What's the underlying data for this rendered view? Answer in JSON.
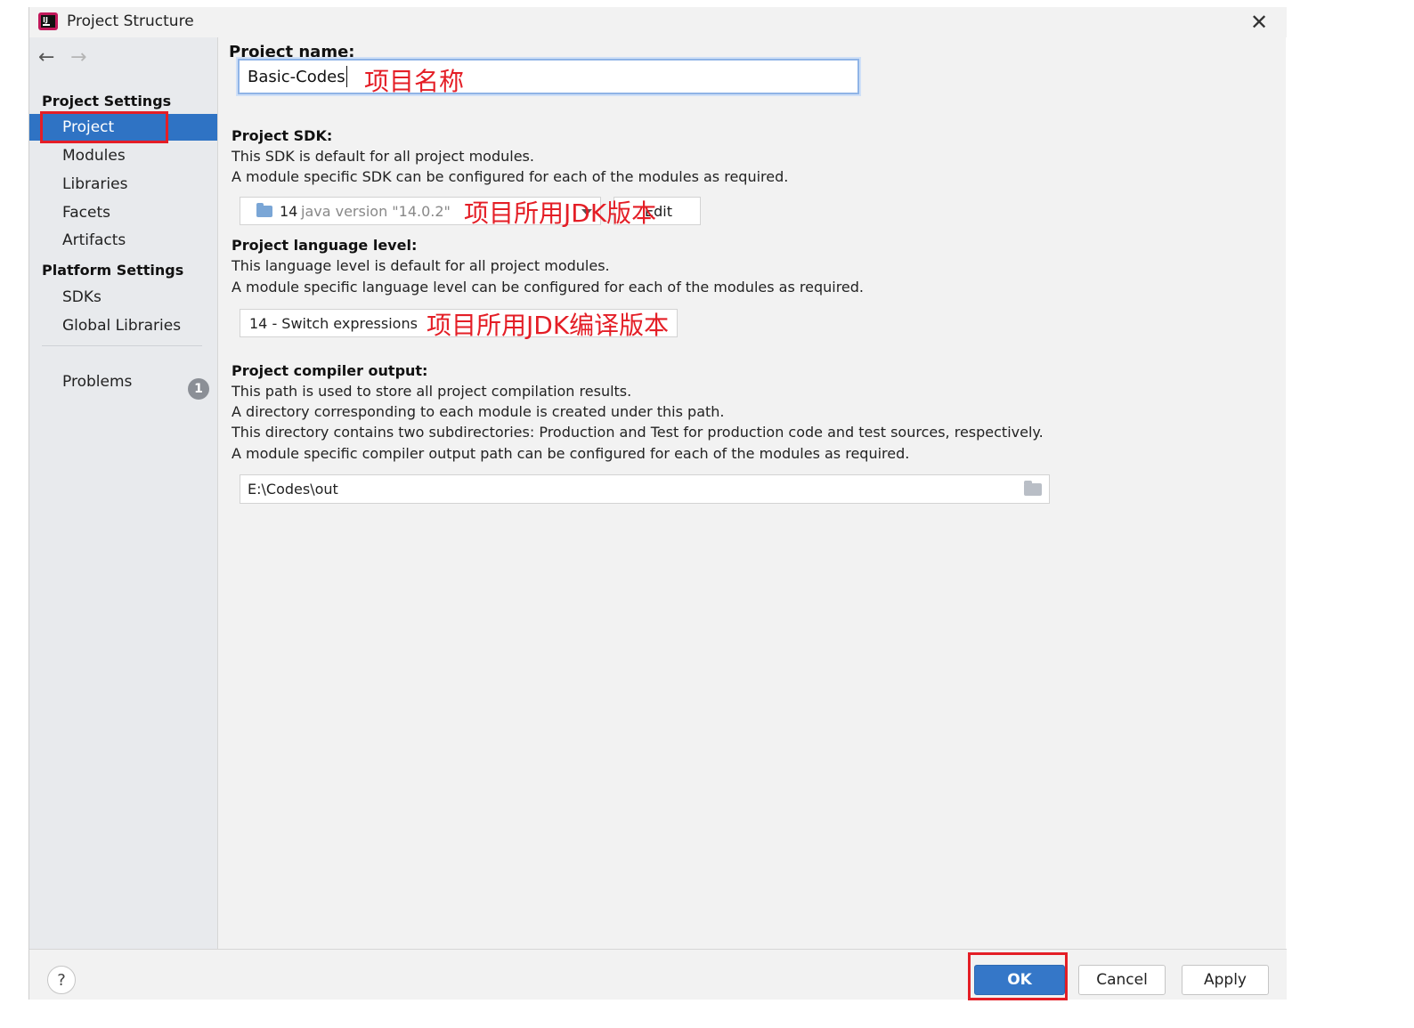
{
  "window": {
    "title": "Project Structure"
  },
  "sidebar": {
    "project_settings_header": "Project Settings",
    "project_items": [
      {
        "label": "Project",
        "selected": true
      },
      {
        "label": "Modules"
      },
      {
        "label": "Libraries"
      },
      {
        "label": "Facets"
      },
      {
        "label": "Artifacts"
      }
    ],
    "platform_settings_header": "Platform Settings",
    "platform_items": [
      {
        "label": "SDKs"
      },
      {
        "label": "Global Libraries"
      }
    ],
    "problems": {
      "label": "Problems",
      "count": "1"
    }
  },
  "project_name": {
    "label": "Project name:",
    "value": "Basic-Codes",
    "annotation": "项目名称"
  },
  "sdk": {
    "label": "Project SDK:",
    "desc1": "This SDK is default for all project modules.",
    "desc2": "A module specific SDK can be configured for each of the modules as required.",
    "version": "14",
    "version_detail": "java version \"14.0.2\"",
    "edit_label": "Edit",
    "annotation": "项目所用JDK版本"
  },
  "language_level": {
    "label": "Project language level:",
    "desc1": "This language level is default for all project modules.",
    "desc2": "A module specific language level can be configured for each of the modules as required.",
    "value": "14 - Switch expressions",
    "annotation": "项目所用JDK编译版本"
  },
  "compiler_output": {
    "label": "Project compiler output:",
    "desc1": "This path is used to store all project compilation results.",
    "desc2": "A directory corresponding to each module is created under this path.",
    "desc3": "This directory contains two subdirectories: Production and Test for production code and test sources, respectively.",
    "desc4": "A module specific compiler output path can be configured for each of the modules as required.",
    "value": "E:\\Codes\\out"
  },
  "footer": {
    "help": "?",
    "ok": "OK",
    "cancel": "Cancel",
    "apply": "Apply"
  },
  "colors": {
    "accent": "#2f73c4",
    "annotation": "#e41e26"
  },
  "icons": [
    "app-icon",
    "close-icon",
    "back-arrow-icon",
    "forward-arrow-icon",
    "sdk-folder-icon",
    "dropdown-arrow-icon",
    "browse-folder-icon",
    "problems-count-badge",
    "help-icon"
  ]
}
